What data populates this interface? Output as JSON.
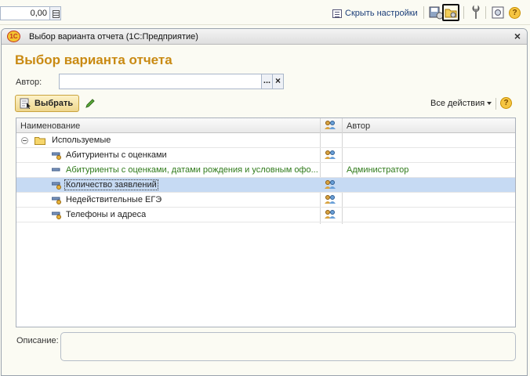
{
  "toolbar": {
    "number_value": "0,00",
    "hide_settings_label": "Скрыть настройки",
    "icons": [
      "save-settings-icon",
      "report-settings-folder-icon",
      "tools-icon",
      "frame-settings-icon",
      "help-icon"
    ],
    "help_glyph": "?"
  },
  "dialog": {
    "window_title": "Выбор варианта отчета  (1С:Предприятие)",
    "logo_text": "1С",
    "close_glyph": "×",
    "form_title": "Выбор варианта отчета",
    "author_label": "Автор:",
    "author_value": "",
    "ellipsis_label": "...",
    "clear_label": "×",
    "select_button_label": "Выбрать",
    "all_actions_label": "Все действия",
    "help_glyph": "?"
  },
  "table": {
    "headers": {
      "name": "Наименование",
      "author": "Автор"
    },
    "group": {
      "label": "Используемые"
    },
    "rows": [
      {
        "name": "Абитуриенты с оценками",
        "author": "",
        "shared": true,
        "selected": false,
        "user_variant": false
      },
      {
        "name": "Абитуриенты с оценками, датами рождения и условным офо...",
        "author": "Администратор",
        "shared": false,
        "selected": false,
        "user_variant": true
      },
      {
        "name": "Количество заявлений",
        "author": "",
        "shared": true,
        "selected": true,
        "user_variant": false
      },
      {
        "name": "Недействительные ЕГЭ",
        "author": "",
        "shared": true,
        "selected": false,
        "user_variant": false
      },
      {
        "name": "Телефоны и адреса",
        "author": "",
        "shared": true,
        "selected": false,
        "user_variant": false
      }
    ]
  },
  "description": {
    "label": "Описание:",
    "value": ""
  },
  "colors": {
    "title_orange": "#c98a13",
    "user_variant_green": "#2f7a1a",
    "selection_blue": "#c6daf3"
  }
}
